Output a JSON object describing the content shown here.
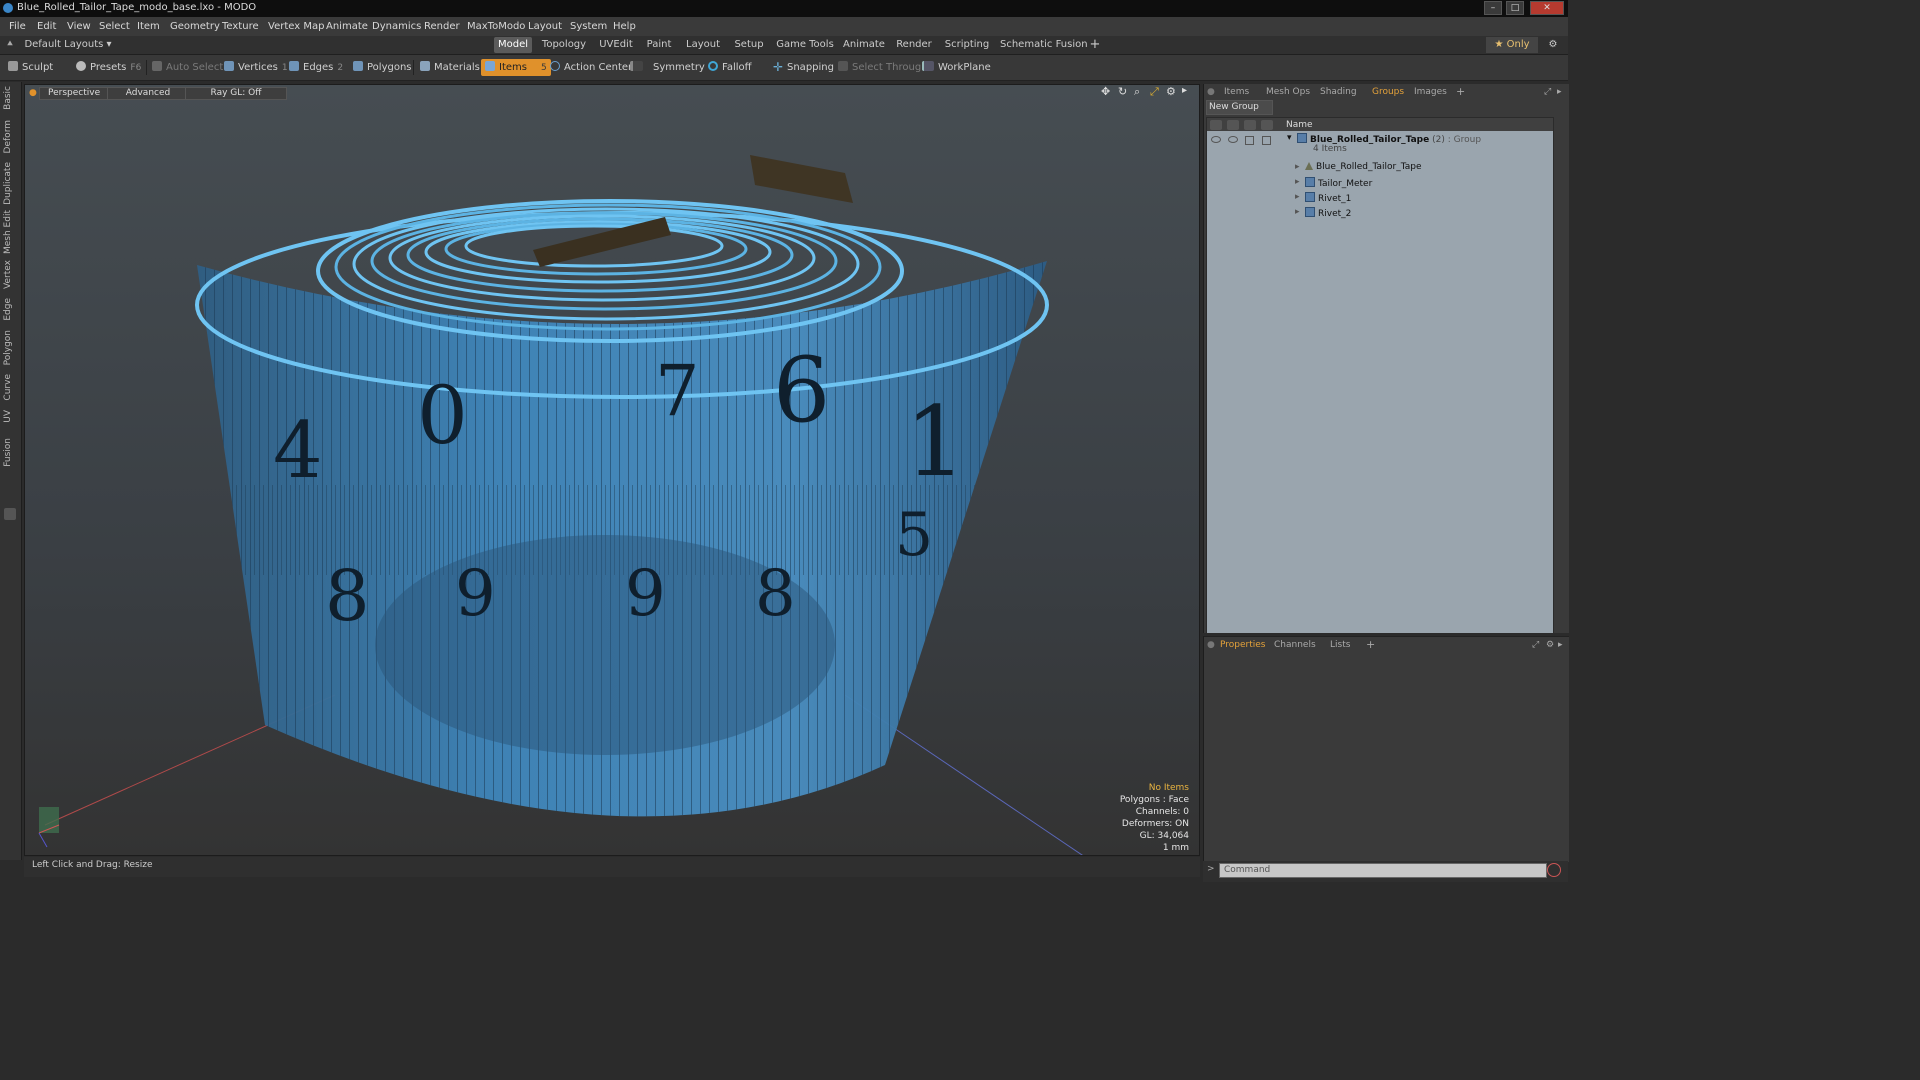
{
  "window": {
    "title": "Blue_Rolled_Tailor_Tape_modo_base.lxo - MODO"
  },
  "menu": [
    "File",
    "Edit",
    "View",
    "Select",
    "Item",
    "Geometry",
    "Texture",
    "Vertex Map",
    "Animate",
    "Dynamics",
    "Render",
    "MaxToModo",
    "Layout",
    "System",
    "Help"
  ],
  "layout_tabs": {
    "preset": "Default Layouts ▾",
    "tabs": [
      "Model",
      "Topology",
      "UVEdit",
      "Paint",
      "Layout",
      "Setup",
      "Game Tools",
      "Animate",
      "Render",
      "Scripting",
      "Schematic Fusion"
    ],
    "active": "Model",
    "only_label": "★  Only"
  },
  "toolbar": {
    "sculpt": "Sculpt",
    "presets": "Presets",
    "presets_key": "F6",
    "auto_select": "Auto Select",
    "vertices": "Vertices",
    "vertices_key": "1",
    "edges": "Edges",
    "edges_key": "2",
    "polygons": "Polygons",
    "materials": "Materials",
    "items": "Items",
    "items_key": "5",
    "action_center": "Action Center",
    "symmetry": "Symmetry",
    "falloff": "Falloff",
    "snapping": "Snapping",
    "select_through": "Select Through",
    "workplane": "WorkPlane"
  },
  "left_tabs": [
    "Basic",
    "Deform",
    "Duplicate",
    "Mesh Edit",
    "Vertex",
    "Edge",
    "Polygon",
    "Curve",
    "UV",
    "Fusion"
  ],
  "viewport": {
    "view": "Perspective",
    "shading": "Advanced",
    "raygl": "Ray GL: Off",
    "hud": {
      "items": "No Items",
      "polygons": "Polygons : Face",
      "channels": "Channels: 0",
      "deformers": "Deformers: ON",
      "gl": "GL: 34,064",
      "scale": "1 mm"
    },
    "tape_numbers": [
      "4",
      "0",
      "7",
      "6",
      "1",
      "5",
      "8",
      "9",
      "9",
      "8"
    ]
  },
  "status": {
    "hint": "Left Click and Drag:  Resize"
  },
  "groups_panel": {
    "tabs": [
      "Items",
      "Mesh Ops",
      "Shading",
      "Groups",
      "Images"
    ],
    "active": "Groups",
    "new_group": "New Group",
    "column_name": "Name",
    "group": {
      "name": "Blue_Rolled_Tailor_Tape",
      "count": "(2)",
      "type": ": Group",
      "sub": "4 Items"
    },
    "items": [
      "Blue_Rolled_Tailor_Tape",
      "Tailor_Meter",
      "Rivet_1",
      "Rivet_2"
    ]
  },
  "props_panel": {
    "tabs": [
      "Properties",
      "Channels",
      "Lists"
    ],
    "active": "Properties"
  },
  "command": {
    "placeholder": "Command"
  },
  "colors": {
    "accent": "#e0912b",
    "tape_blue": "#3f8fc4",
    "tape_edge": "#6fc4f2"
  }
}
